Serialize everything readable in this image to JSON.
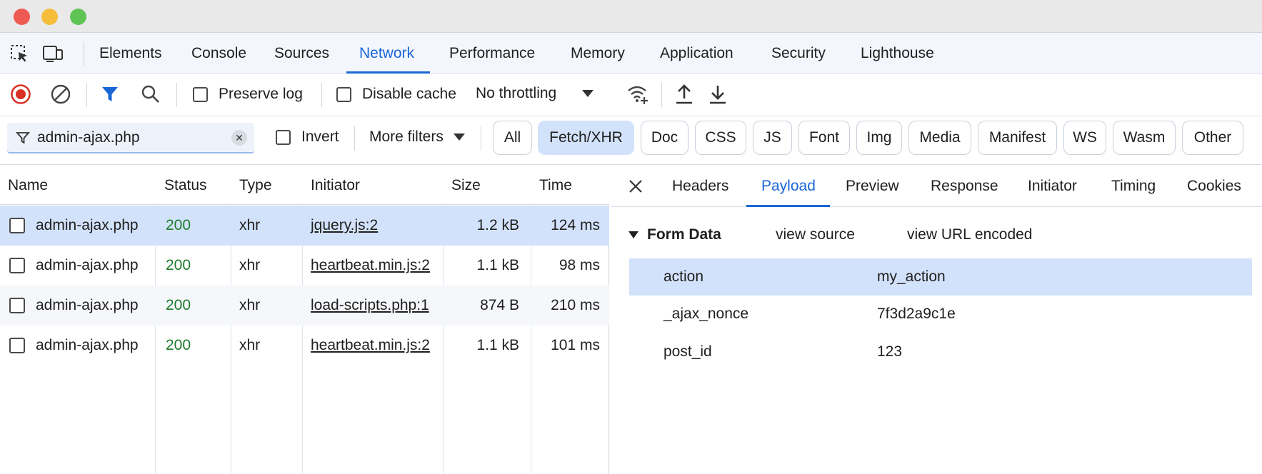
{
  "devtools": {
    "tabs": [
      {
        "label": "Elements"
      },
      {
        "label": "Console"
      },
      {
        "label": "Sources"
      },
      {
        "label": "Network",
        "active": true
      },
      {
        "label": "Performance"
      },
      {
        "label": "Memory"
      },
      {
        "label": "Application"
      },
      {
        "label": "Security"
      },
      {
        "label": "Lighthouse"
      }
    ],
    "icons": {
      "inspect": "inspect-element-icon",
      "device": "device-toolbar-icon"
    }
  },
  "toolbar": {
    "record_icon": "record-icon",
    "clear_icon": "clear-icon",
    "filter_icon": "filter-icon",
    "search_icon": "search-icon",
    "preserve_log": "Preserve log",
    "disable_cache": "Disable cache",
    "throttling": "No throttling",
    "network_conditions_icon": "wifi-settings-icon",
    "import_icon": "upload-icon",
    "export_icon": "download-icon"
  },
  "filterbar": {
    "filter_value": "admin-ajax.php",
    "invert": "Invert",
    "more_filters": "More filters",
    "types": [
      {
        "label": "All"
      },
      {
        "label": "Fetch/XHR",
        "active": true
      },
      {
        "label": "Doc"
      },
      {
        "label": "CSS"
      },
      {
        "label": "JS"
      },
      {
        "label": "Font"
      },
      {
        "label": "Img"
      },
      {
        "label": "Media"
      },
      {
        "label": "Manifest"
      },
      {
        "label": "WS"
      },
      {
        "label": "Wasm"
      },
      {
        "label": "Other"
      }
    ]
  },
  "requests": {
    "columns": [
      "Name",
      "Status",
      "Type",
      "Initiator",
      "Size",
      "Time"
    ],
    "rows": [
      {
        "name": "admin-ajax.php",
        "status": "200",
        "type": "xhr",
        "initiator": "jquery.js:2",
        "size": "1.2 kB",
        "time": "124 ms",
        "selected": true
      },
      {
        "name": "admin-ajax.php",
        "status": "200",
        "type": "xhr",
        "initiator": "heartbeat.min.js:2",
        "size": "1.1 kB",
        "time": "98 ms"
      },
      {
        "name": "admin-ajax.php",
        "status": "200",
        "type": "xhr",
        "initiator": "load-scripts.php:1",
        "size": "874 B",
        "time": "210 ms"
      },
      {
        "name": "admin-ajax.php",
        "status": "200",
        "type": "xhr",
        "initiator": "heartbeat.min.js:2",
        "size": "1.1 kB",
        "time": "101 ms"
      }
    ]
  },
  "details": {
    "tabs": [
      {
        "label": "Headers"
      },
      {
        "label": "Payload",
        "active": true
      },
      {
        "label": "Preview"
      },
      {
        "label": "Response"
      },
      {
        "label": "Initiator"
      },
      {
        "label": "Timing"
      },
      {
        "label": "Cookies"
      }
    ],
    "form_data": {
      "title": "Form Data",
      "view_source": "view source",
      "view_url_encoded": "view URL encoded",
      "fields": [
        {
          "key": "action",
          "value": "my_action",
          "selected": true
        },
        {
          "key": "_ajax_nonce",
          "value": "7f3d2a9c1e"
        },
        {
          "key": "post_id",
          "value": "123"
        }
      ]
    }
  },
  "colors": {
    "accent": "#1a66d6",
    "selected_row": "#d3e2fb",
    "status_ok": "#1e7d2e",
    "record": "#d93025"
  }
}
